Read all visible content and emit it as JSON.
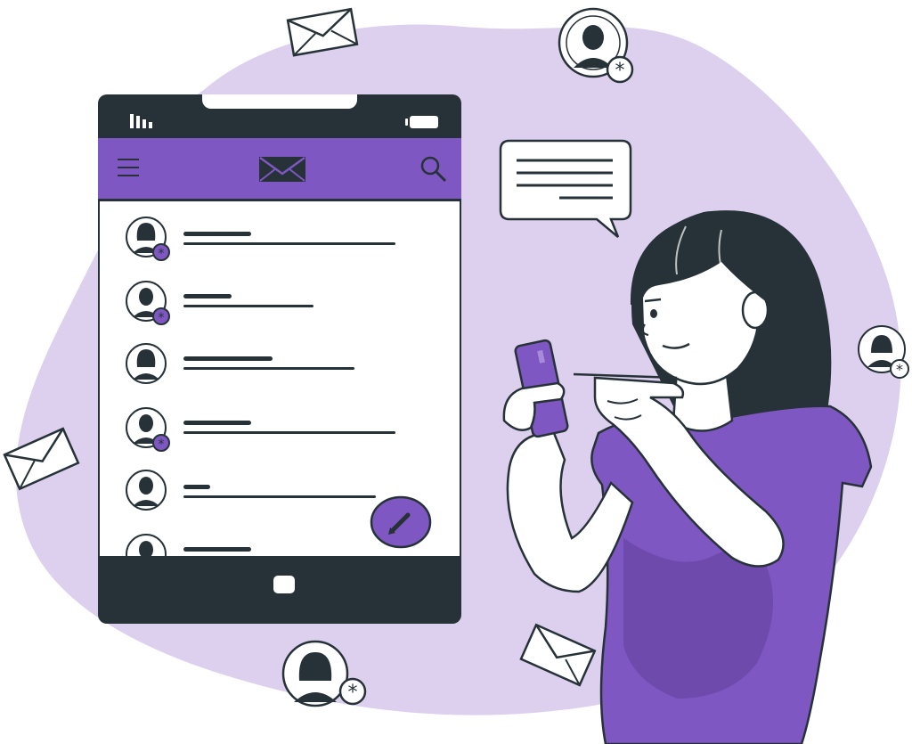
{
  "illustration": {
    "subject": "woman-using-mail-app",
    "colors": {
      "accent": "#7e57c2",
      "blob": "#dcd0ee",
      "dark": "#263238",
      "shirt_shadow": "#5e3f9a",
      "skin": "#ffffff"
    }
  },
  "phone": {
    "status_bar": {
      "icons": [
        "signal-icon",
        "battery-icon"
      ]
    },
    "app_bar": {
      "icons": [
        "menu-icon",
        "mail-icon",
        "search-icon"
      ]
    },
    "inbox": {
      "rows": [
        {
          "avatar": "woman-avatar",
          "unread": true
        },
        {
          "avatar": "man-avatar",
          "unread": true
        },
        {
          "avatar": "woman-avatar",
          "unread": false
        },
        {
          "avatar": "man-avatar",
          "unread": true
        },
        {
          "avatar": "man-avatar",
          "unread": false
        },
        {
          "avatar": "man-avatar",
          "unread": false
        }
      ]
    },
    "fab": {
      "icon": "pencil-icon"
    },
    "home_button": {
      "icon": "home-button"
    }
  },
  "floating_items": [
    "envelope-icon",
    "envelope-icon",
    "envelope-icon",
    "avatar-badge",
    "avatar-badge",
    "avatar-badge",
    "chat-bubble"
  ]
}
